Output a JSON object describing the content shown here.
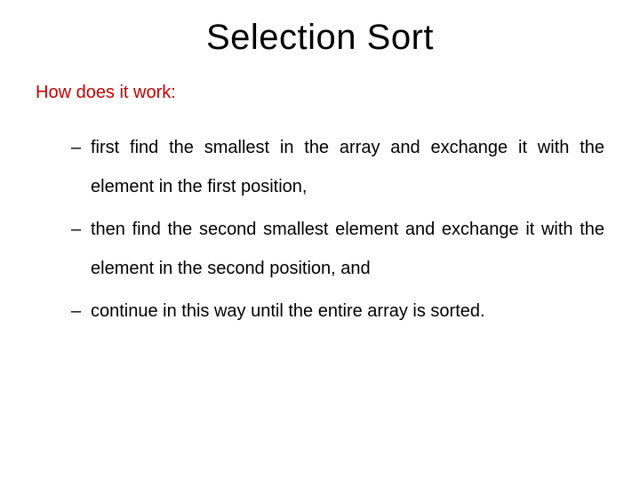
{
  "title": "Selection Sort",
  "subhead": "How does it work:",
  "bullets": [
    "first find the smallest in the array and exchange it with the element in the first position,",
    "then find the second smallest element and exchange it with the element in the second position, and",
    "continue in this way until the entire array is sorted."
  ]
}
